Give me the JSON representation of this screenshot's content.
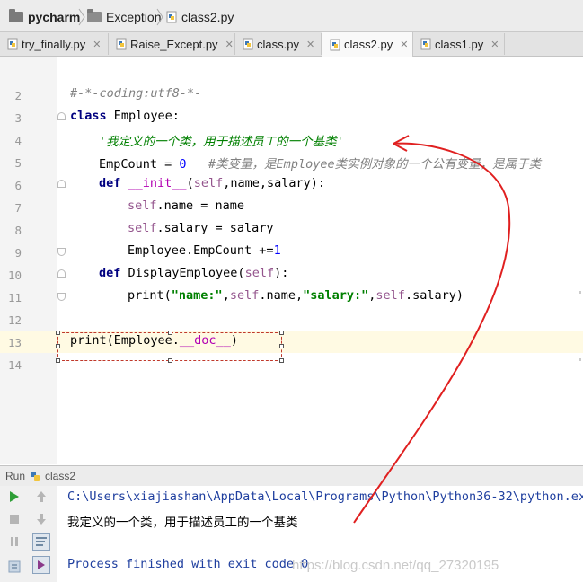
{
  "breadcrumb": {
    "items": [
      {
        "label": "pycharm",
        "icon": "folder-icon"
      },
      {
        "label": "Exception",
        "icon": "folder-icon"
      },
      {
        "label": "class2.py",
        "icon": "python-file-icon"
      }
    ]
  },
  "tabs": [
    {
      "label": "try_finally.py",
      "active": false
    },
    {
      "label": "Raise_Except.py",
      "active": false
    },
    {
      "label": "class.py",
      "active": false
    },
    {
      "label": "class2.py",
      "active": true
    },
    {
      "label": "class1.py",
      "active": false
    }
  ],
  "editor": {
    "line_numbers": [
      "2",
      "3",
      "4",
      "5",
      "6",
      "7",
      "8",
      "9",
      "10",
      "11",
      "12",
      "13",
      "14"
    ],
    "lines": {
      "l2": "#-*-coding:utf8-*-",
      "l3_kw": "class",
      "l3_rest": " Employee:",
      "l4": "'我定义的一个类，用于描述员工的一个基类'",
      "l5_code": "EmpCount = ",
      "l5_num": "0",
      "l5_comment": "   #类变量，是Employee类实例对象的一个公有变量，是属于类",
      "l6_kw": "def",
      "l6_sp": " ",
      "l6_magic": "__init__",
      "l6_p1": "(",
      "l6_self": "self",
      "l6_rest": ",name,salary):",
      "l7_self": "self",
      "l7_rest": ".name = name",
      "l8_self": "self",
      "l8_rest": ".salary = salary",
      "l9_code": "Employee.EmpCount +=",
      "l9_num": "1",
      "l10_kw": "def",
      "l10_rest": " DisplayEmployee(",
      "l10_self": "self",
      "l10_end": "):",
      "l11_a": "print(",
      "l11_s1": "\"name:\"",
      "l11_b": ",",
      "l11_self1": "self",
      "l11_c": ".name,",
      "l11_s2": "\"salary:\"",
      "l11_d": ",",
      "l11_self2": "self",
      "l11_e": ".salary)",
      "l13_a": "print(Employee.",
      "l13_magic": "__doc__",
      "l13_b": ")"
    }
  },
  "run": {
    "header_label": "Run",
    "config_name": "class2",
    "output": [
      "C:\\Users\\xiajiashan\\AppData\\Local\\Programs\\Python\\Python36-32\\python.ex",
      "我定义的一个类，用于描述员工的一个基类",
      "",
      "Process finished with exit code 0"
    ],
    "watermark": "https://blog.csdn.net/qq_27320195"
  },
  "colors": {
    "annotation_arrow": "#e02020",
    "keyword": "#000080",
    "string": "#008000",
    "self": "#94558d",
    "comment": "#808080",
    "current_line": "#fffae3"
  }
}
